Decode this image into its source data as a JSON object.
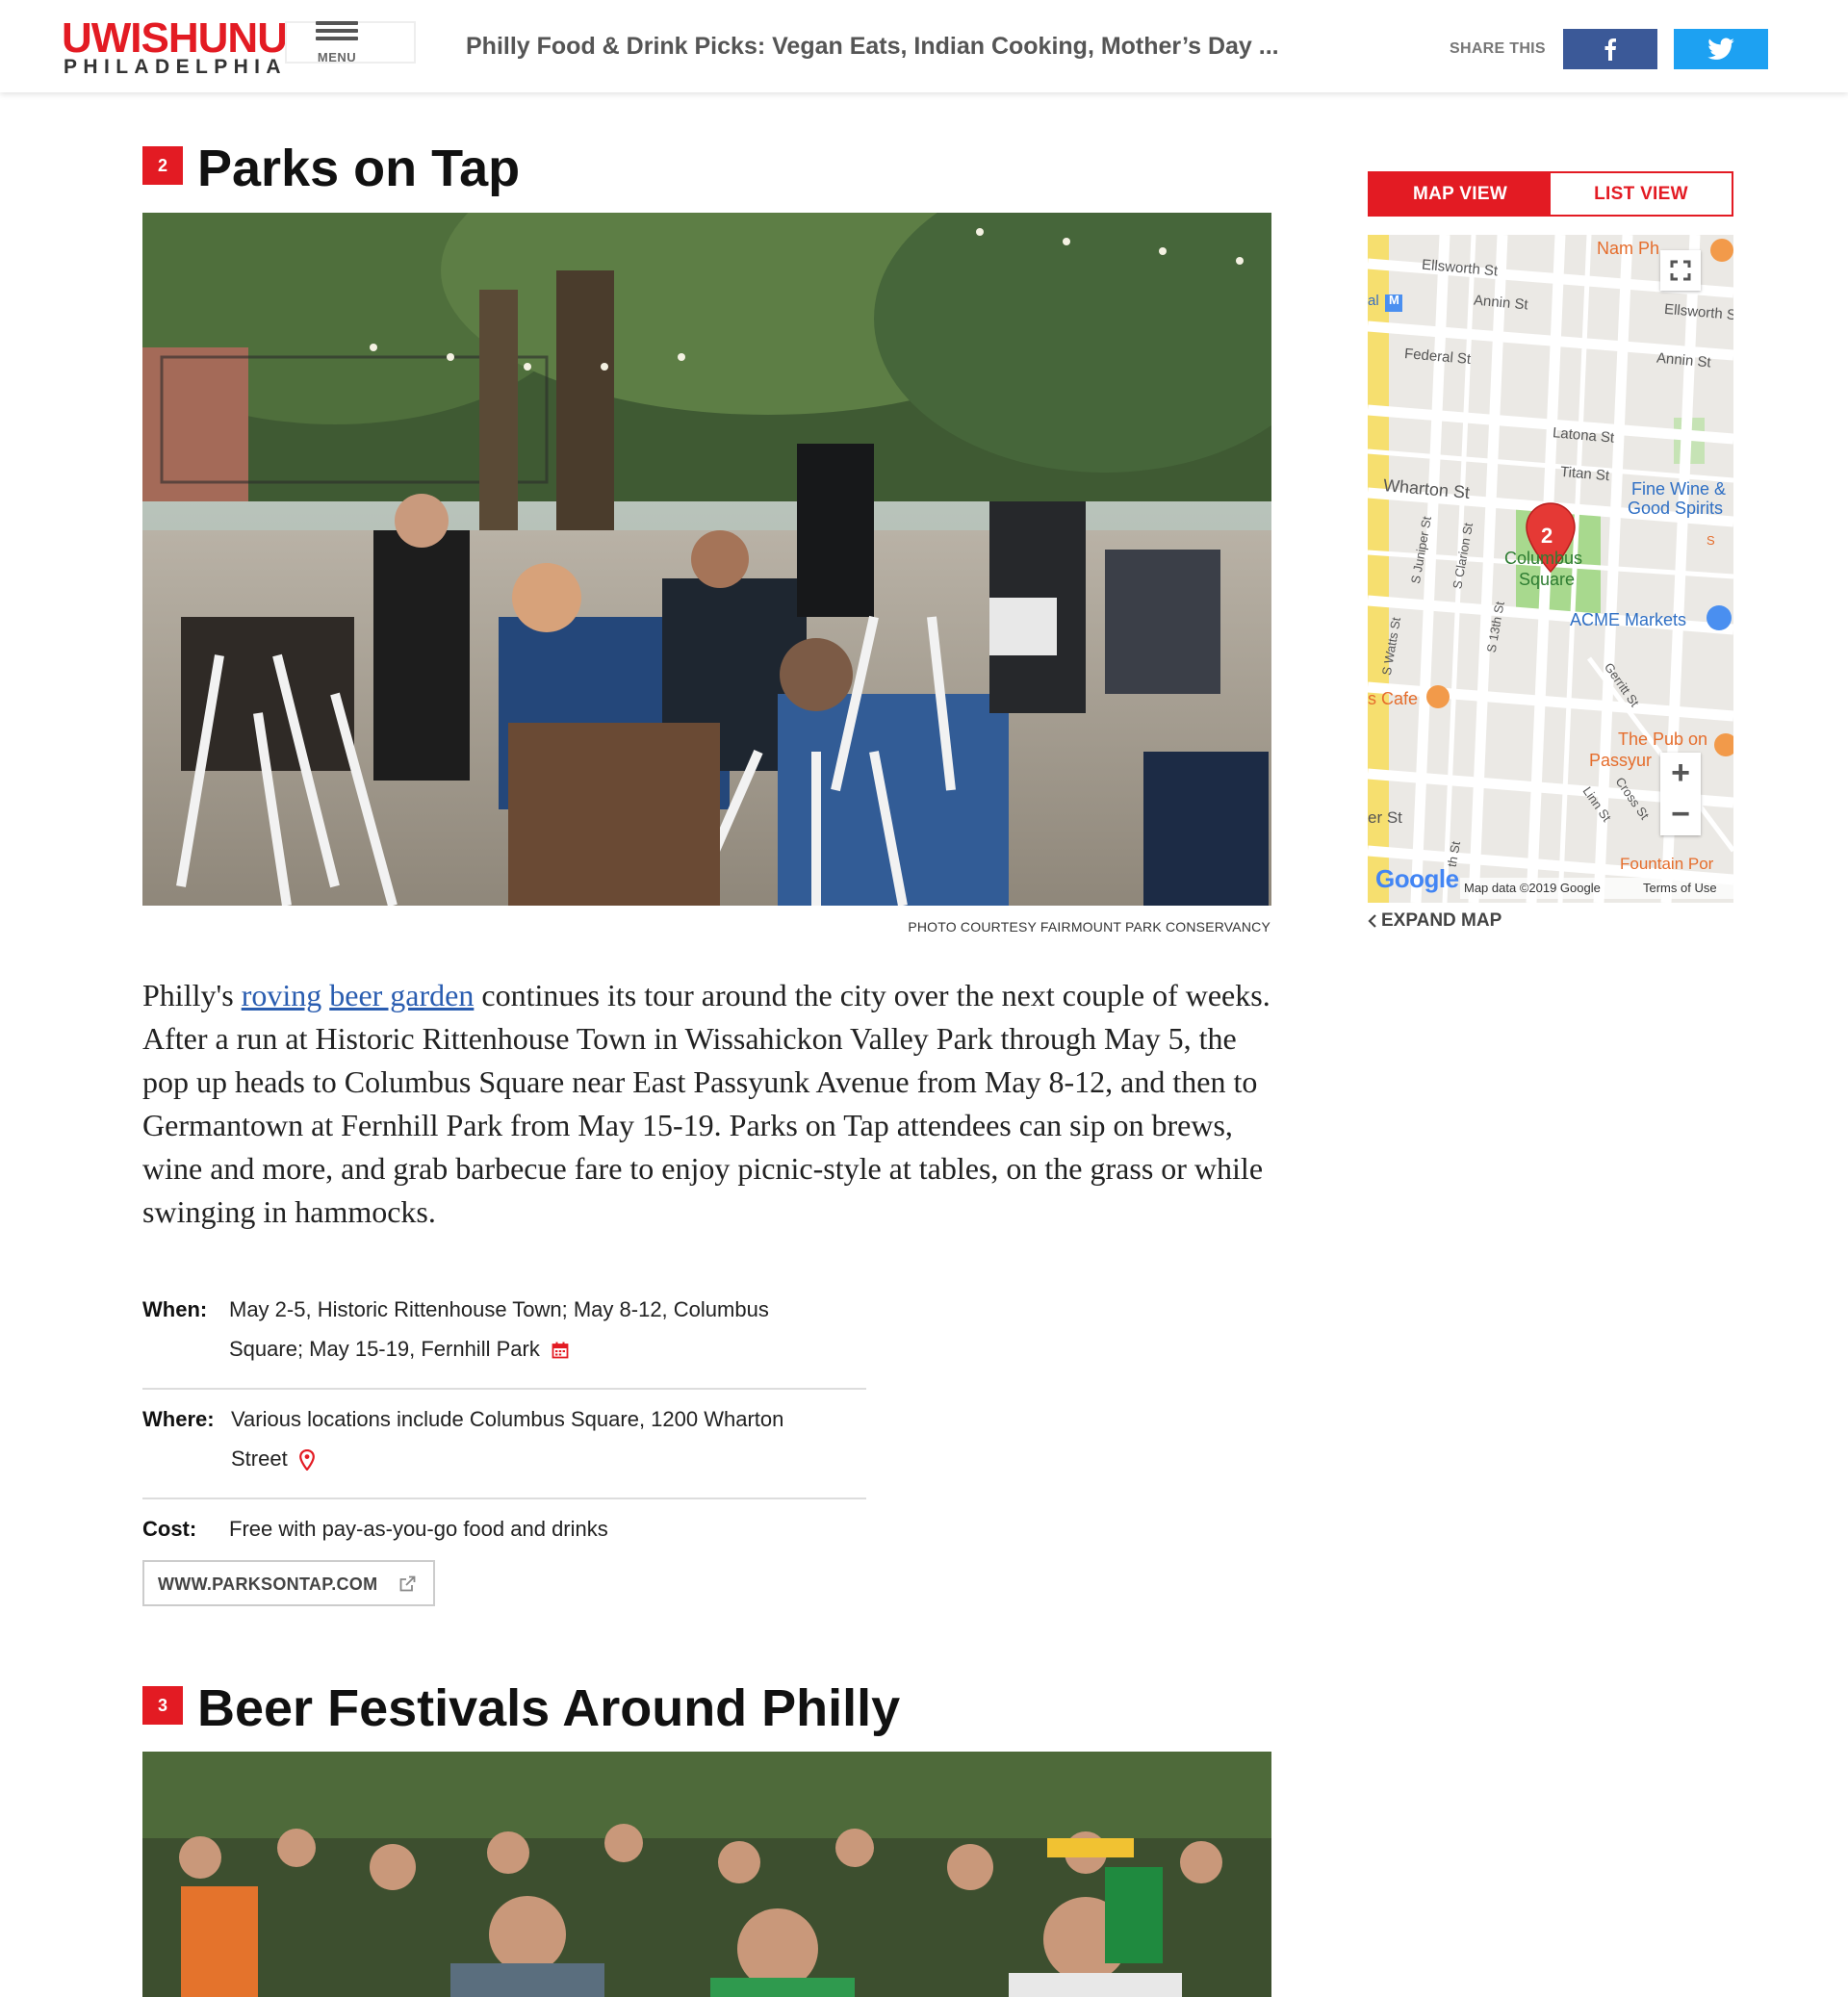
{
  "header": {
    "logo_main": "UWISHUNU",
    "logo_sub": "PHILADELPHIA",
    "menu_label": "MENU",
    "article_title": "Philly Food & Drink Picks: Vegan Eats, Indian Cooking, Mother’s Day ...",
    "share_label": "SHARE THIS",
    "facebook_icon": "facebook-icon",
    "twitter_icon": "twitter-icon",
    "facebook_color": "#3b5998",
    "twitter_color": "#1da1f2"
  },
  "listing2": {
    "number": "2",
    "title": "Parks on Tap",
    "photo_credit": "PHOTO COURTESY FAIRMOUNT PARK CONSERVANCY",
    "body_before": "Philly's ",
    "body_link1": "roving",
    "body_space": " ",
    "body_link2": "beer garden",
    "body_after": " continues its tour around the city over the next couple of weeks. After a run at Historic Rittenhouse Town in Wissahickon Valley Park through May 5, the pop up heads to Columbus Square near East Passyunk Avenue from May 8-12, and then to Germantown at Fernhill Park from May 15-19. Parks on Tap attendees can sip on brews, wine and more, and grab barbecue fare to enjoy picnic-style at tables, on the grass or while swinging in hammocks.",
    "when_label": "When:",
    "when_value": "May 2-5, Historic Rittenhouse Town; May 8-12, Columbus Square; May 15-19, Fernhill Park",
    "where_label": "Where:",
    "where_value": "Various locations include Columbus Square, 1200 Wharton Street",
    "cost_label": "Cost:",
    "cost_value": "Free with pay-as-you-go food and drinks",
    "website_label": "WWW.PARKSONTAP.COM"
  },
  "listing3": {
    "number": "3",
    "title": "Beer Festivals Around Philly"
  },
  "sidebar": {
    "tab_map": "MAP VIEW",
    "tab_list": "LIST VIEW",
    "expand_label": "EXPAND MAP",
    "map": {
      "marker_number": "2",
      "streets": [
        "Ellsworth St",
        "Annin St",
        "Ellsworth S",
        "Annin St",
        "Federal St",
        "Latona St",
        "Titan St",
        "Wharton St",
        "S Juniper St",
        "S Clarion St",
        "S 13th St",
        "S Watts St",
        "Gerritt St",
        "Linn St",
        "Cross St",
        "er St",
        "th St",
        "S"
      ],
      "places": [
        "Nam Ph",
        "Fine Wine &",
        "Good Spirits",
        "Columbus",
        "Square",
        "ACME Markets",
        "s Cafe",
        "The Pub on",
        "Passyur",
        "Fountain Por",
        "al"
      ],
      "metro_label": "M",
      "google_logo": "Google",
      "map_data": "Map data ©2019 Google",
      "terms": "Terms of Use",
      "zoom_in": "+",
      "zoom_out": "−"
    }
  }
}
